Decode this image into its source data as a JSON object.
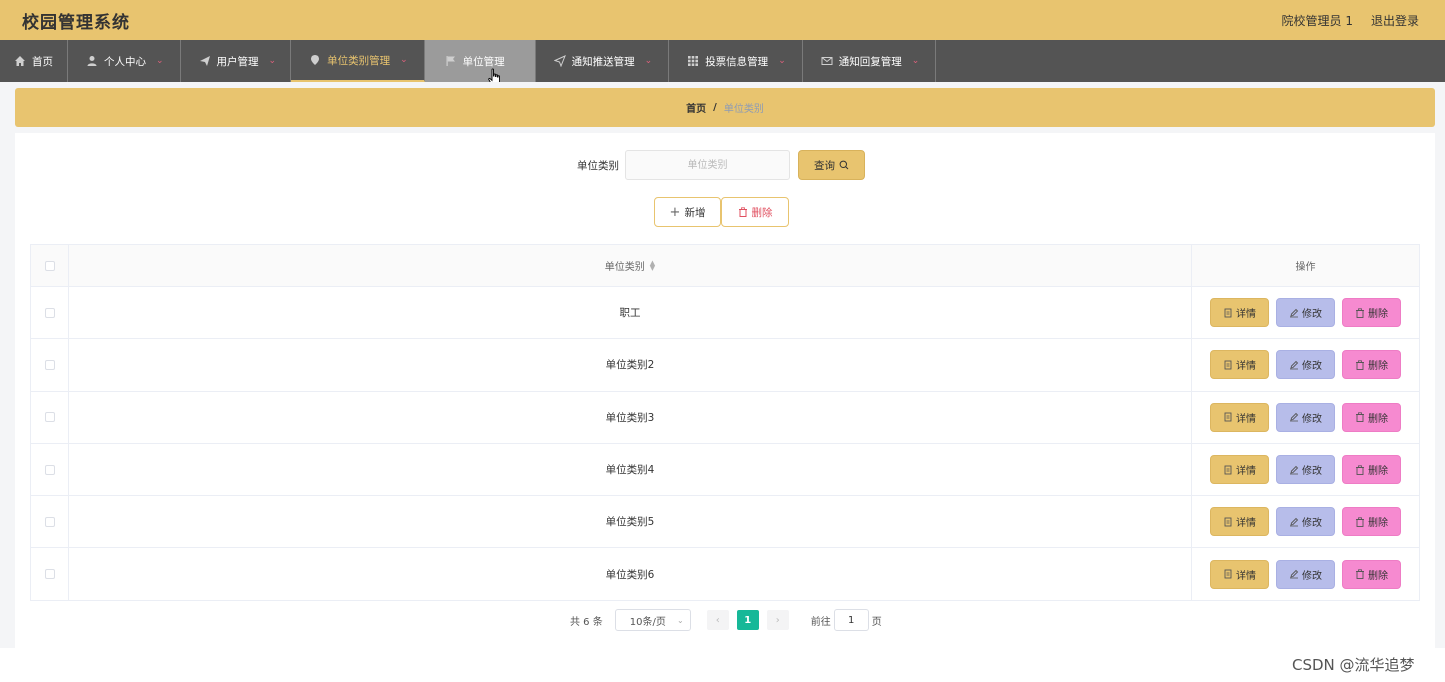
{
  "header": {
    "title": "校园管理系统",
    "user": "院校管理员 1",
    "logout": "退出登录"
  },
  "nav": [
    {
      "label": "首页",
      "icon": "home-icon",
      "caret": false
    },
    {
      "label": "个人中心",
      "icon": "user-icon",
      "caret": true
    },
    {
      "label": "用户管理",
      "icon": "send-icon",
      "caret": true
    },
    {
      "label": "单位类别管理",
      "icon": "location-pin-icon",
      "caret": true
    },
    {
      "label": "单位管理",
      "icon": "flag-icon",
      "caret": false
    },
    {
      "label": "通知推送管理",
      "icon": "paper-plane-icon",
      "caret": true
    },
    {
      "label": "投票信息管理",
      "icon": "grid-icon",
      "caret": true
    },
    {
      "label": "通知回复管理",
      "icon": "mail-icon",
      "caret": true
    }
  ],
  "breadcrumb": {
    "home": "首页",
    "separator": "/",
    "current": "单位类别"
  },
  "search": {
    "label": "单位类别",
    "placeholder": "单位类别",
    "value": "",
    "button": "查询"
  },
  "actions": {
    "add": "新增",
    "delete": "删除"
  },
  "table": {
    "headers": {
      "name": "单位类别",
      "ops": "操作"
    },
    "rows": [
      {
        "name": "职工"
      },
      {
        "name": "单位类别2"
      },
      {
        "name": "单位类别3"
      },
      {
        "name": "单位类别4"
      },
      {
        "name": "单位类别5"
      },
      {
        "name": "单位类别6"
      }
    ],
    "row_actions": {
      "detail": "详情",
      "edit": "修改",
      "delete": "删除"
    }
  },
  "pagination": {
    "total": "共 6 条",
    "page_size": "10条/页",
    "current_page": "1",
    "goto_prefix": "前往",
    "goto_value": "1",
    "goto_suffix": "页"
  },
  "watermark": "CSDN @流华追梦",
  "colors": {
    "accent": "#e8c46f",
    "nav_bg": "#545454",
    "edit": "#b7bdea",
    "delete": "#f68ad0",
    "page_active": "#16b898"
  }
}
